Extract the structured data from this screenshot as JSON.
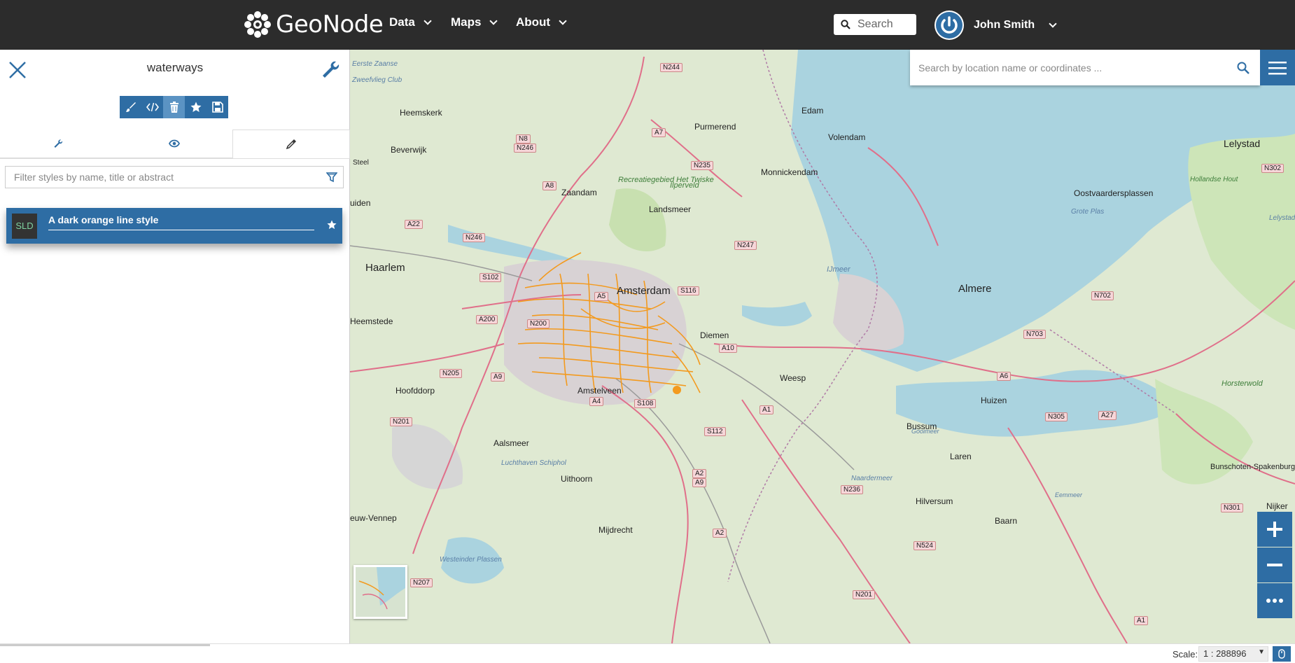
{
  "navbar": {
    "brand": "GeoNode",
    "menu": [
      {
        "label": "Data"
      },
      {
        "label": "Maps"
      },
      {
        "label": "About"
      }
    ],
    "search_placeholder": "Search",
    "user_name": "John Smith"
  },
  "panel": {
    "title": "waterways",
    "filter_placeholder": "Filter styles by name, title or abstract",
    "style_item": {
      "badge": "SLD",
      "title": "A dark orange line style"
    }
  },
  "map": {
    "location_search_placeholder": "Search by location name or coordinates ...",
    "places": [
      "Lelystad",
      "Edam",
      "Purmerend",
      "Volendam",
      "Heemskerk",
      "Beverwijk",
      "Monnickendam",
      "Zaandam",
      "Landsmeer",
      "Haarlem",
      "Amsterdam",
      "Almere",
      "Heemstede",
      "Diemen",
      "Hoofddorp",
      "Amstelveen",
      "Weesp",
      "Huizen",
      "Bussum",
      "Aalsmeer",
      "Laren",
      "Uithoorn",
      "Hilversum",
      "Mijdrecht",
      "Baarn",
      "Oostvaardersplassen",
      "Horsterwold",
      "IJmeer",
      "Bunschoten-Spakenburg",
      "Nijker",
      "Zweefvlieg Club",
      "Eerste Zaanse",
      "Recreatiegebied Het Twiske",
      "Ilperveld",
      "Westeinder Plassen",
      "Luchthaven Schiphol",
      "Gooimeer",
      "Naardermeer",
      "Eemmeer",
      "Hollandse Hout",
      "Grote Plas",
      "Lelystad Airport",
      "uiden",
      "euw-Vennep",
      "Steel"
    ],
    "roads": [
      "N244",
      "A7",
      "N8",
      "N246",
      "N235",
      "A8",
      "N302",
      "A22",
      "N246",
      "N247",
      "S102",
      "A5",
      "S116",
      "N702",
      "A200",
      "N200",
      "A10",
      "N703",
      "N205",
      "A9",
      "A4",
      "S108",
      "A1",
      "A6",
      "N305",
      "A27",
      "N201",
      "S112",
      "A2",
      "A9",
      "N236",
      "N301",
      "N524",
      "A2",
      "N207",
      "N201",
      "A1"
    ]
  },
  "footer": {
    "scale_label": "Scale:",
    "scale_value": "1 : 288896"
  },
  "colors": {
    "navbar_bg": "#2c2c2c",
    "primary": "#2e6da4",
    "waterways": "#f39a1e",
    "water": "#aad3df",
    "land": "#dfe9d2"
  }
}
